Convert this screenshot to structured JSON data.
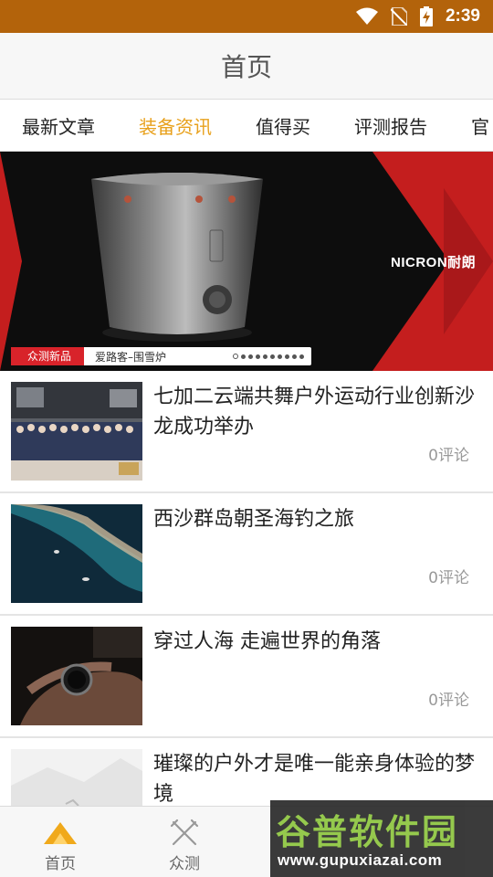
{
  "status_bar": {
    "time": "2:39",
    "icons": [
      "wifi-icon",
      "no-sim-icon",
      "battery-charging-icon"
    ]
  },
  "header": {
    "title": "首页"
  },
  "tabs": [
    {
      "label": "最新文章",
      "active": false
    },
    {
      "label": "装备资讯",
      "active": true
    },
    {
      "label": "值得买",
      "active": false
    },
    {
      "label": "评测报告",
      "active": false
    },
    {
      "label": "官",
      "active": false
    }
  ],
  "banner": {
    "tag": "众测新品",
    "title": "爱路客–围雪炉",
    "brand": "NICRON耐朗",
    "slide_count": 10,
    "active_slide": 0
  },
  "articles": [
    {
      "title": "七加二云端共舞户外运动行业创新沙龙成功举办",
      "comments": "0评论",
      "thumb": "group-photo-thumbnail"
    },
    {
      "title": "西沙群岛朝圣海钓之旅",
      "comments": "0评论",
      "thumb": "ocean-aerial-thumbnail"
    },
    {
      "title": "穿过人海 走遍世界的角落",
      "comments": "0评论",
      "thumb": "watch-wrist-thumbnail"
    },
    {
      "title": "璀璨的户外才是唯一能亲身体验的梦境",
      "comments": "",
      "thumb": "snow-mountain-thumbnail"
    }
  ],
  "bottom_nav": [
    {
      "label": "首页",
      "icon": "home-mountain-icon",
      "active": true
    },
    {
      "label": "众测",
      "icon": "crossed-tools-icon",
      "active": false
    }
  ],
  "watermark": {
    "cn": "谷普软件园",
    "url": "www.gupuxiazai.com"
  },
  "colors": {
    "status_bar": "#b3630b",
    "accent": "#e8a11d",
    "banner_red": "#c41e1e"
  }
}
